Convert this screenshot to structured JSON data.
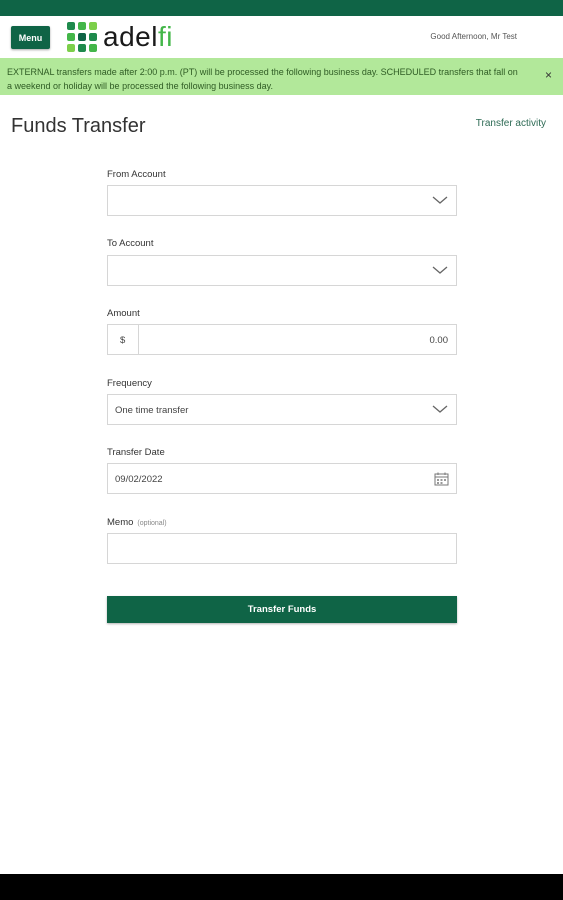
{
  "header": {
    "menu_label": "Menu",
    "logo_text_main": "adel",
    "logo_text_accent": "fi",
    "greeting": "Good Afternoon, Mr Test"
  },
  "banner": {
    "message": "EXTERNAL transfers made after 2:00 p.m. (PT) will be processed the following business day. SCHEDULED transfers that fall on a weekend or holiday will be processed the following business day.",
    "close_label": "×"
  },
  "page": {
    "title": "Funds Transfer",
    "activity_link": "Transfer activity"
  },
  "form": {
    "from_account": {
      "label": "From Account",
      "value": ""
    },
    "to_account": {
      "label": "To Account",
      "value": ""
    },
    "amount": {
      "label": "Amount",
      "currency_symbol": "$",
      "value": "0.00"
    },
    "frequency": {
      "label": "Frequency",
      "value": "One time transfer"
    },
    "transfer_date": {
      "label": "Transfer Date",
      "value": "09/02/2022"
    },
    "memo": {
      "label": "Memo",
      "optional_tag": "(optional)",
      "value": ""
    },
    "submit_label": "Transfer Funds"
  },
  "colors": {
    "brand_dark_green": "#0f6446",
    "brand_light_green": "#43b649",
    "banner_bg": "#b2e89a"
  },
  "icons": [
    "menu-button",
    "logo-mark-icon",
    "close-icon",
    "chevron-down-icon",
    "calendar-icon"
  ]
}
